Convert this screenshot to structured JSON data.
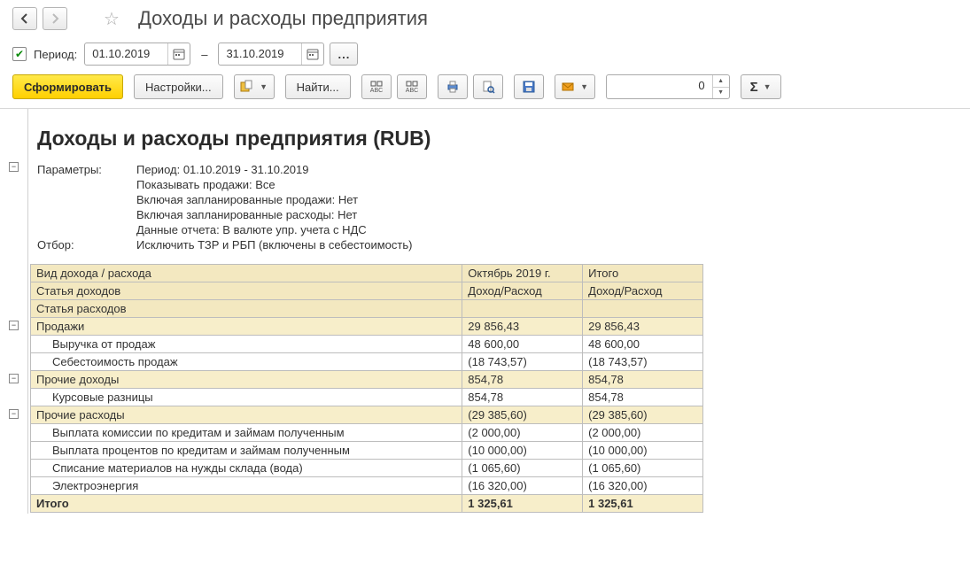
{
  "title": "Доходы и расходы предприятия",
  "period": {
    "label": "Период:",
    "from": "01.10.2019",
    "to": "31.10.2019",
    "checked": true,
    "dash": "–"
  },
  "toolbar": {
    "generate": "Сформировать",
    "settings": "Настройки...",
    "find": "Найти...",
    "num_value": "0"
  },
  "report": {
    "title": "Доходы и расходы предприятия (RUB)",
    "params_label": "Параметры:",
    "filter_label": "Отбор:",
    "params": [
      "Период: 01.10.2019 - 31.10.2019",
      "Показывать продажи: Все",
      "Включая запланированные продажи: Нет",
      "Включая запланированные расходы: Нет",
      "Данные отчета: В валюте упр. учета с НДС"
    ],
    "filter": "Исключить ТЗР и РБП (включены в себестоимость)",
    "header": {
      "c1a": "Вид дохода / расхода",
      "c1b": "Статья доходов",
      "c1c": "Статья расходов",
      "c2a": "Октябрь 2019 г.",
      "c3a": "Итого",
      "c2b": "Доход/Расход",
      "c3b": "Доход/Расход"
    },
    "rows": [
      {
        "type": "grp",
        "name": "Продажи",
        "v1": "29 856,43",
        "v2": "29 856,43"
      },
      {
        "type": "row",
        "name": "Выручка от продаж",
        "v1": "48 600,00",
        "v2": "48 600,00"
      },
      {
        "type": "row",
        "name": "Себестоимость продаж",
        "v1": "(18 743,57)",
        "v2": "(18 743,57)"
      },
      {
        "type": "grp",
        "name": "Прочие доходы",
        "v1": "854,78",
        "v2": "854,78"
      },
      {
        "type": "row",
        "name": "Курсовые разницы",
        "v1": "854,78",
        "v2": "854,78"
      },
      {
        "type": "grp",
        "name": "Прочие расходы",
        "v1": "(29 385,60)",
        "v2": "(29 385,60)"
      },
      {
        "type": "row",
        "name": "Выплата комиссии по кредитам и займам полученным",
        "v1": "(2 000,00)",
        "v2": "(2 000,00)"
      },
      {
        "type": "row",
        "name": "Выплата процентов по кредитам и займам полученным",
        "v1": "(10 000,00)",
        "v2": "(10 000,00)"
      },
      {
        "type": "row",
        "name": "Списание материалов на нужды склада (вода)",
        "v1": "(1 065,60)",
        "v2": "(1 065,60)"
      },
      {
        "type": "row",
        "name": "Электроэнергия",
        "v1": "(16 320,00)",
        "v2": "(16 320,00)"
      },
      {
        "type": "tot",
        "name": "Итого",
        "v1": "1 325,61",
        "v2": "1 325,61"
      }
    ]
  }
}
